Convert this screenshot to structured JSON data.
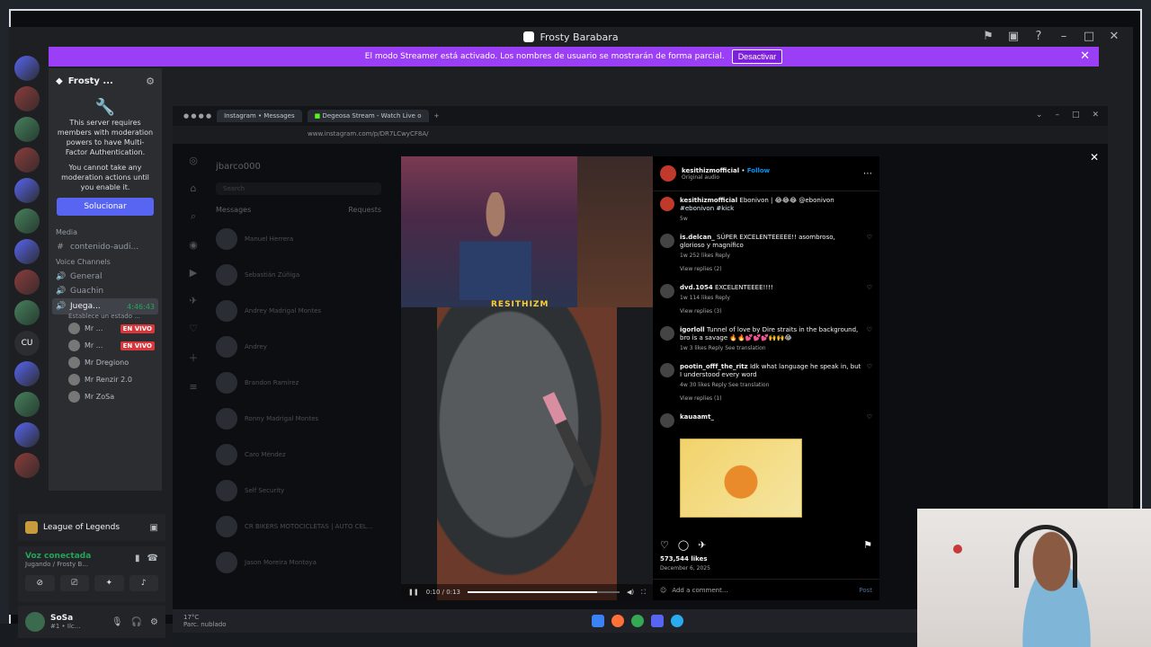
{
  "window": {
    "title": "Frosty Barabara"
  },
  "banner": {
    "text": "El modo Streamer está activado. Los nombres de usuario se mostrarán de forma parcial.",
    "button": "Desactivar"
  },
  "server": {
    "name": "Frosty ...",
    "mfa_line1": "This server requires members with moderation powers to have Multi-Factor Authentication.",
    "mfa_line2": "You cannot take any moderation actions until you enable it.",
    "fix_button": "Solucionar"
  },
  "channels": {
    "media_label": "Media",
    "text_channel": "contenido-audi...",
    "voice_label": "Voice Channels",
    "general": "General",
    "guachin": "Guachin",
    "active": "Juega...",
    "active_timer": "4:46:43",
    "active_status": "Establece un estado ..."
  },
  "voice_users": [
    {
      "name": "Mr ...",
      "live": "EN VIVO"
    },
    {
      "name": "Mr ...",
      "live": "EN VIVO"
    },
    {
      "name": "Mr Dregiono",
      "live": ""
    },
    {
      "name": "Mr Renzir 2.0",
      "live": ""
    },
    {
      "name": "Mr ZoSa",
      "live": ""
    }
  ],
  "game_activity": {
    "name": "League of Legends"
  },
  "voice": {
    "status": "Voz conectada",
    "sub": "Jugando / Frosty B..."
  },
  "user": {
    "name": "SoSa",
    "sub": "#1 • Ilc..."
  },
  "stream": {
    "tab_instagram": "Instagram • Messages",
    "tab_kick": "Degeosa Stream - Watch Live o",
    "url": "www.instagram.com/p/DR7LCwyCF8A/",
    "dm_handle": "jbarco000",
    "dm_search": "Search",
    "dm_messages": "Messages",
    "dm_requests": "Requests",
    "dm_people": [
      "Manuel Herrera",
      "Sebastián Zúñiga",
      "Andrey Madrigal Montes",
      "Andrey",
      "Brandon Ramírez",
      "Ronny Madrigal Montes",
      "Caro Méndez",
      "Self Security",
      "CR BIKERS MOTOCICLETAS | AUTO CEL...",
      "Jason Moreira Montoya"
    ],
    "video_overlay": "RESITHIZM",
    "video_time": "0:10 / 0:13",
    "video_progress": 0.85,
    "taskbar_temp": "17°C",
    "taskbar_weather": "Parc. nublado"
  },
  "post": {
    "author": "kesithizmofficial",
    "follow": "Follow",
    "audio": "Original audio",
    "caption_user": "kesithizmofficial",
    "caption": "Ebonivon | 😂😂😂 @ebonivon",
    "hashtags": "#ebonivon #kick",
    "caption_time": "5w",
    "comments": [
      {
        "user": "is.delcan_",
        "text": "SÚPER EXCELENTEEEEE!! asombroso, glorioso y magnífico",
        "meta": "1w   252 likes   Reply",
        "replies": "View replies (2)"
      },
      {
        "user": "dvd.1054",
        "text": "EXCELENTEEEE!!!!",
        "meta": "1w   114 likes   Reply",
        "replies": "View replies (3)"
      },
      {
        "user": "igorloll",
        "text": "Tunnel of love by Dire straits in the background, bro is a savage 🔥🔥💕💕💕🙌🙌😂",
        "meta": "1w   3 likes   Reply   See translation",
        "replies": ""
      },
      {
        "user": "pootin_offf_the_ritz",
        "text": "Idk what language he speak in, but I understood every word",
        "meta": "4w   30 likes   Reply   See translation",
        "replies": "View replies (1)"
      },
      {
        "user": "kauaamt_",
        "text": "",
        "meta": "",
        "replies": ""
      }
    ],
    "likes": "573,544 likes",
    "date": "December 6, 2025",
    "add_comment": "Add a comment...",
    "post_button": "Post"
  }
}
